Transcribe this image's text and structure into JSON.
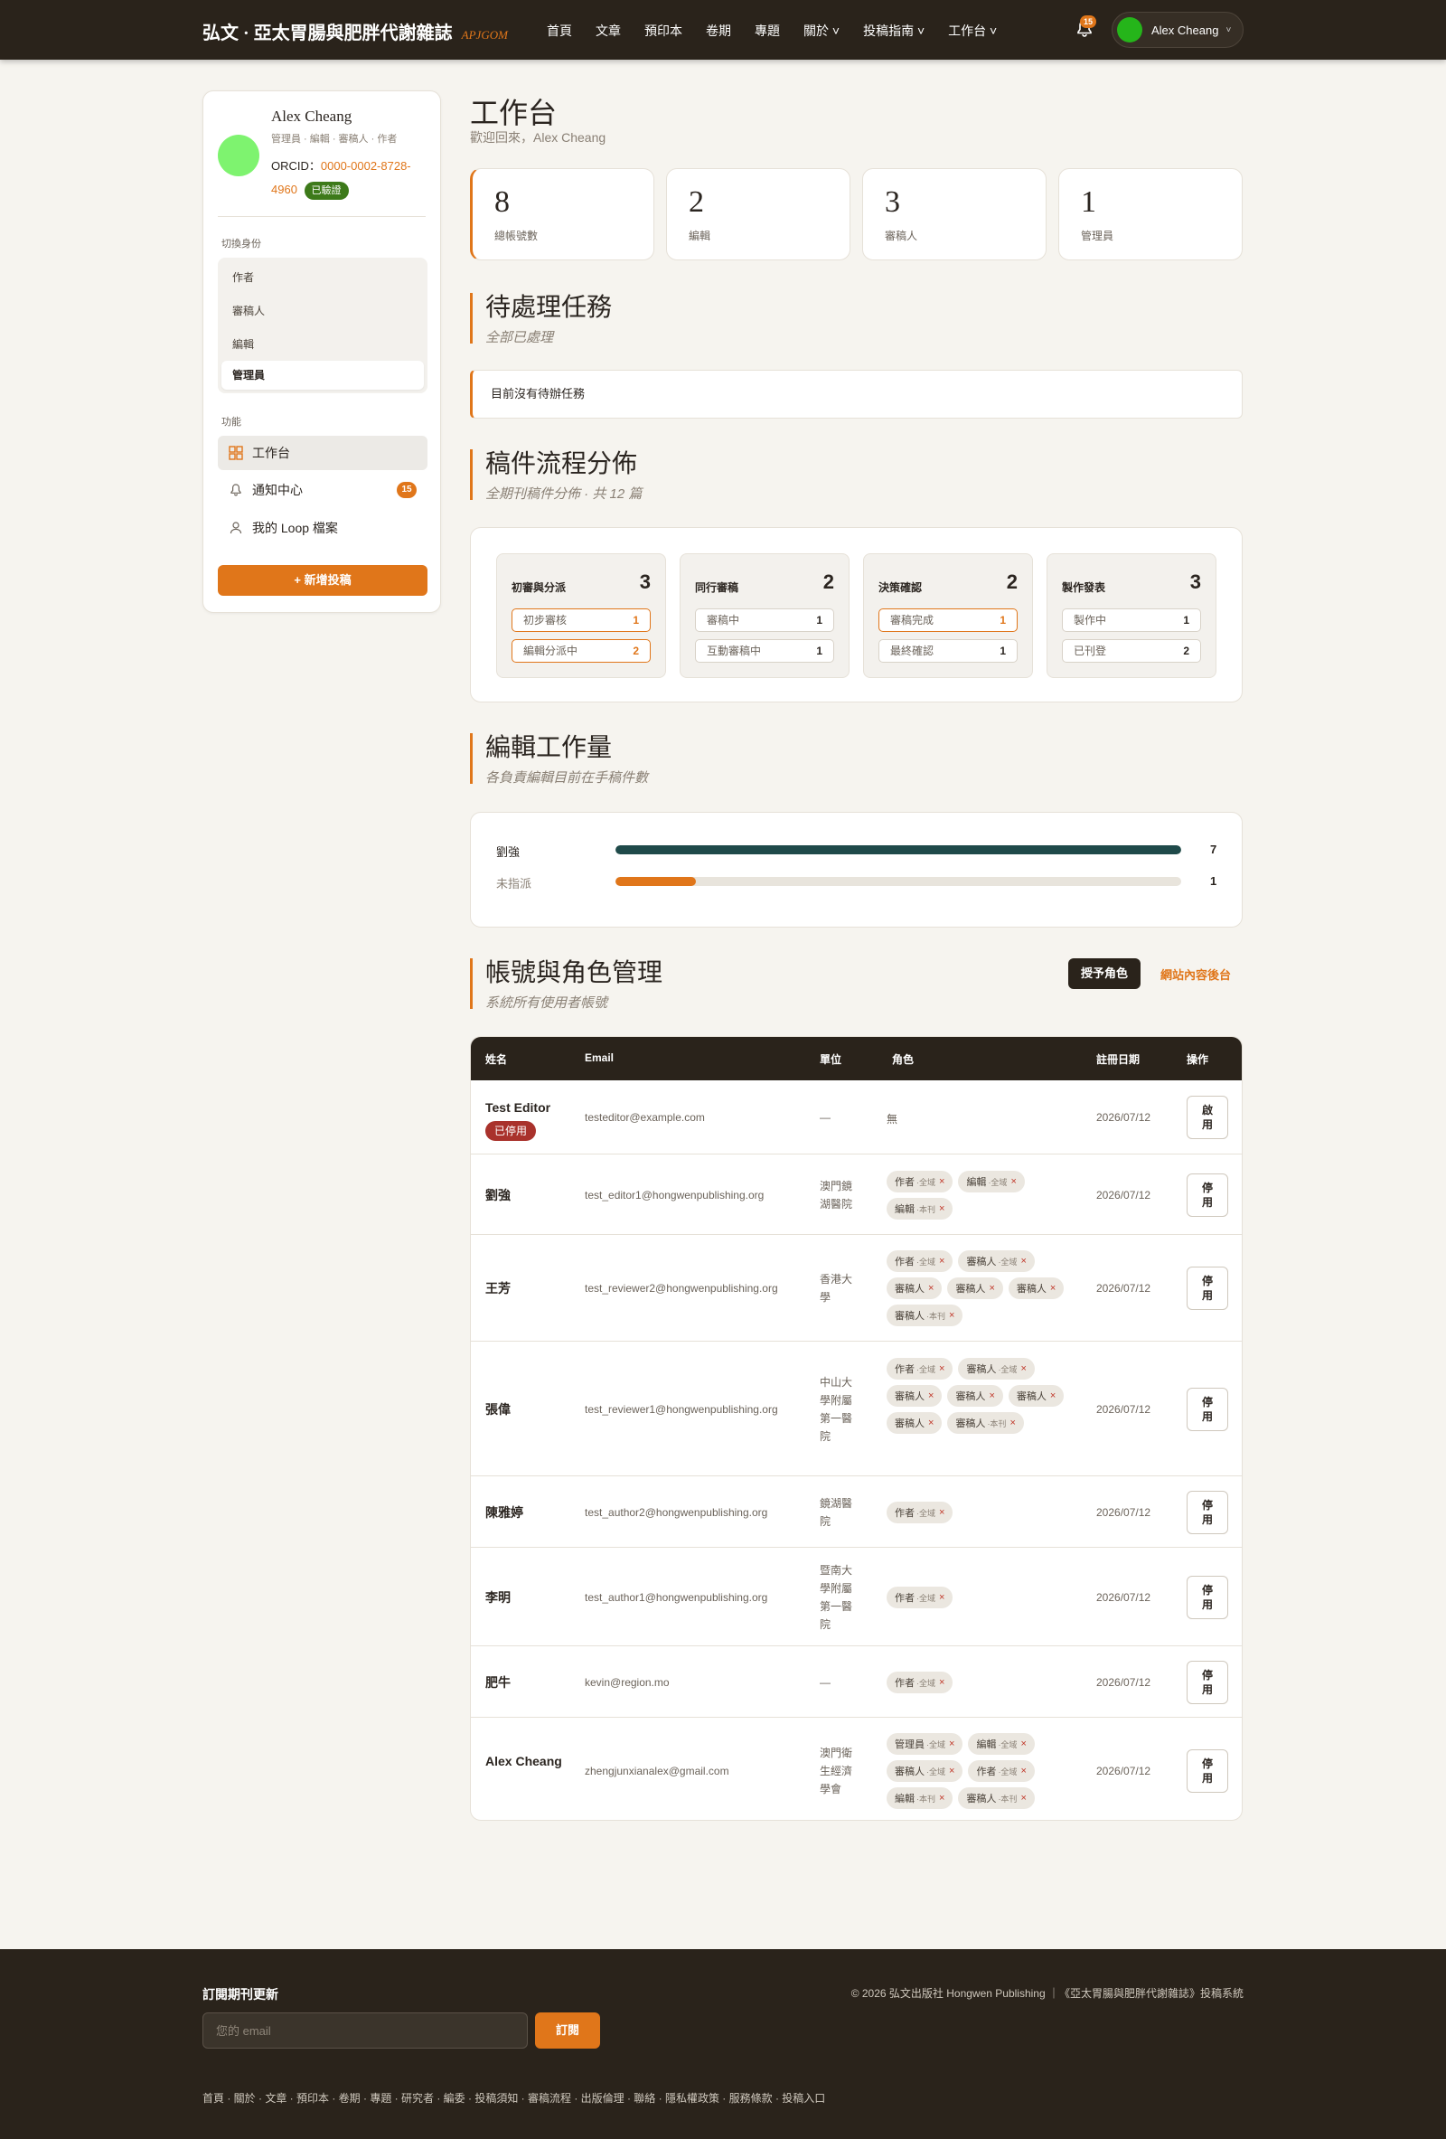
{
  "header": {
    "brand": "弘文 · 亞太胃腸與肥胖代謝雜誌",
    "brand_abbr": "APJGOM",
    "nav": [
      "首頁",
      "文章",
      "預印本",
      "卷期",
      "專題",
      "關於 ˅",
      "投稿指南 ˅",
      "工作台 ˅"
    ],
    "notification_count": "15",
    "user_name": "Alex Cheang"
  },
  "sidebar": {
    "name": "Alex Cheang",
    "roles_line": "管理員 · 編輯 · 審稿人 · 作者",
    "orcid_label": "ORCID：",
    "orcid_value": "0000-0002-8728-4960",
    "verified": "已驗證",
    "switch_label": "切換身份",
    "identities": [
      "作者",
      "審稿人",
      "編輯",
      "管理員"
    ],
    "function_label": "功能",
    "functions": [
      "工作台",
      "通知中心",
      "我的 Loop 檔案"
    ],
    "notification_badge": "15",
    "new_submission": "+ 新增投稿"
  },
  "main": {
    "title": "工作台",
    "welcome": "歡迎回來，Alex Cheang",
    "stats": [
      {
        "value": "8",
        "label": "總帳號數"
      },
      {
        "value": "2",
        "label": "編輯"
      },
      {
        "value": "3",
        "label": "審稿人"
      },
      {
        "value": "1",
        "label": "管理員"
      }
    ],
    "pending": {
      "title": "待處理任務",
      "subtitle": "全部已處理",
      "empty": "目前沒有待辦任務"
    },
    "flow": {
      "title": "稿件流程分佈",
      "subtitle": "全期刊稿件分佈 · 共 12 篇",
      "stages": [
        {
          "title": "初審與分派",
          "count": "3",
          "subs": [
            {
              "label": "初步審核",
              "count": "1",
              "hl": true
            },
            {
              "label": "編輯分派中",
              "count": "2",
              "hl": true
            }
          ]
        },
        {
          "title": "同行審稿",
          "count": "2",
          "subs": [
            {
              "label": "審稿中",
              "count": "1",
              "hl": false
            },
            {
              "label": "互動審稿中",
              "count": "1",
              "hl": false
            }
          ]
        },
        {
          "title": "決策確認",
          "count": "2",
          "subs": [
            {
              "label": "審稿完成",
              "count": "1",
              "hl": true
            },
            {
              "label": "最終確認",
              "count": "1",
              "hl": false
            }
          ]
        },
        {
          "title": "製作發表",
          "count": "3",
          "subs": [
            {
              "label": "製作中",
              "count": "1",
              "hl": false
            },
            {
              "label": "已刊登",
              "count": "2",
              "hl": false
            }
          ]
        }
      ]
    },
    "workload": {
      "title": "編輯工作量",
      "subtitle": "各負責編輯目前在手稿件數",
      "max": 7,
      "rows": [
        {
          "name": "劉強",
          "value": 7,
          "value_text": "7",
          "color": "#1f4a4a"
        },
        {
          "name": "未指派",
          "value": 1,
          "value_text": "1",
          "color": "#e0761a"
        }
      ]
    },
    "accounts": {
      "title": "帳號與角色管理",
      "subtitle": "系統所有使用者帳號",
      "grant_button": "授予角色",
      "cms_link": "網站內容後台",
      "columns": [
        "姓名",
        "Email",
        "單位",
        "角色",
        "註冊日期",
        "操作"
      ],
      "rows": [
        {
          "name": "Test Editor",
          "stopped": "已停用",
          "email": "testeditor@example.com",
          "unit": "—",
          "roles": [],
          "no_role": "無",
          "date": "2026/07/12",
          "action": "啟用"
        },
        {
          "name": "劉強",
          "email": "test_editor1@hongwenpublishing.org",
          "unit": "澳門鏡湖醫院",
          "roles": [
            {
              "r": "作者",
              "s": "·全域"
            },
            {
              "r": "編輯",
              "s": "·全域"
            },
            {
              "r": "編輯",
              "s": "·本刊"
            }
          ],
          "date": "2026/07/12",
          "action": "停用"
        },
        {
          "name": "王芳",
          "email": "test_reviewer2@hongwenpublishing.org",
          "unit": "香港大學",
          "roles": [
            {
              "r": "作者",
              "s": "·全域"
            },
            {
              "r": "審稿人",
              "s": "·全域"
            },
            {
              "r": "審稿人",
              "s": ""
            },
            {
              "r": "審稿人",
              "s": ""
            },
            {
              "r": "審稿人",
              "s": ""
            },
            {
              "r": "審稿人",
              "s": "·本刊"
            }
          ],
          "date": "2026/07/12",
          "action": "停用"
        },
        {
          "name": "張偉",
          "email": "test_reviewer1@hongwenpublishing.org",
          "unit": "中山大學附屬第一醫院",
          "roles": [
            {
              "r": "作者",
              "s": "·全域"
            },
            {
              "r": "審稿人",
              "s": "·全域"
            },
            {
              "r": "審稿人",
              "s": ""
            },
            {
              "r": "審稿人",
              "s": ""
            },
            {
              "r": "審稿人",
              "s": ""
            },
            {
              "r": "審稿人",
              "s": ""
            },
            {
              "r": "審稿人",
              "s": "·本刊"
            }
          ],
          "date": "2026/07/12",
          "action": "停用"
        },
        {
          "name": "陳雅婷",
          "email": "test_author2@hongwenpublishing.org",
          "unit": "鏡湖醫院",
          "roles": [
            {
              "r": "作者",
              "s": "·全域"
            }
          ],
          "date": "2026/07/12",
          "action": "停用"
        },
        {
          "name": "李明",
          "email": "test_author1@hongwenpublishing.org",
          "unit": "暨南大學附屬第一醫院",
          "roles": [
            {
              "r": "作者",
              "s": "·全域"
            }
          ],
          "date": "2026/07/12",
          "action": "停用"
        },
        {
          "name": "肥牛",
          "email": "kevin@region.mo",
          "unit": "—",
          "roles": [
            {
              "r": "作者",
              "s": "·全域"
            }
          ],
          "date": "2026/07/12",
          "action": "停用"
        },
        {
          "name": "Alex Cheang",
          "email": "zhengjunxianalex@gmail.com",
          "unit": "澳門衛生經濟學會",
          "roles": [
            {
              "r": "管理員",
              "s": "·全域"
            },
            {
              "r": "編輯",
              "s": "·全域"
            },
            {
              "r": "審稿人",
              "s": "·全域"
            },
            {
              "r": "作者",
              "s": "·全域"
            },
            {
              "r": "編輯",
              "s": "·本刊"
            },
            {
              "r": "審稿人",
              "s": "·本刊"
            }
          ],
          "date": "2026/07/12",
          "action": "停用"
        }
      ]
    }
  },
  "footer": {
    "subscribe_title": "訂閱期刊更新",
    "email_placeholder": "您的 email",
    "subscribe_button": "訂閱",
    "copyright": "© 2026 弘文出版社 Hongwen Publishing ｜《亞太胃腸與肥胖代謝雜誌》投稿系統",
    "links": "首頁 · 關於 · 文章 · 預印本 · 卷期 · 專題 · 研究者 · 編委 · 投稿須知 · 審稿流程 · 出版倫理 · 聯絡 · 隱私權政策 · 服務條款 · 投稿入口"
  }
}
